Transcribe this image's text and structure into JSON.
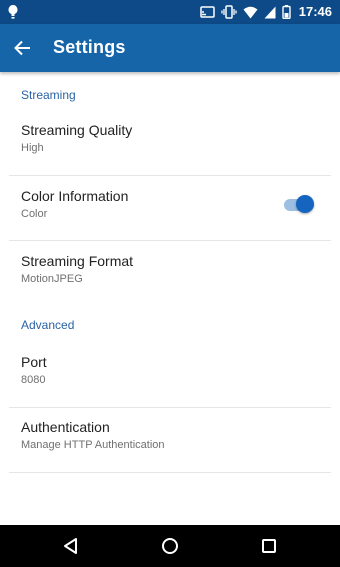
{
  "status_bar": {
    "time": "17:46",
    "icons": [
      "notification-icon",
      "cast-icon",
      "vibrate-icon",
      "wifi-icon",
      "signal-icon",
      "battery-icon"
    ]
  },
  "app_bar": {
    "title": "Settings",
    "back_icon": "arrow-back-icon",
    "background_color": "#1565a8",
    "status_color": "#0d4a87"
  },
  "sections": [
    {
      "header": "Streaming",
      "items": [
        {
          "title": "Streaming Quality",
          "summary": "High"
        },
        {
          "title": "Color Information",
          "summary": "Color",
          "toggle_on": true
        },
        {
          "title": "Streaming Format",
          "summary": "MotionJPEG"
        }
      ]
    },
    {
      "header": "Advanced",
      "items": [
        {
          "title": "Port",
          "summary": "8080"
        },
        {
          "title": "Authentication",
          "summary": "Manage HTTP Authentication"
        }
      ]
    }
  ],
  "nav_bar": {
    "buttons": [
      "back-triangle-icon",
      "home-circle-icon",
      "recents-square-icon"
    ]
  },
  "colors": {
    "accent": "#1565c0",
    "section_header": "#2a63a6",
    "toggle_track": "#9dbfe3"
  }
}
